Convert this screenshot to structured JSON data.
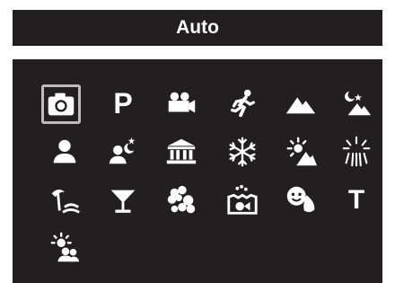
{
  "title": "Auto",
  "selected_mode": "auto-camera",
  "modes": [
    {
      "icon": "camera-icon",
      "label": ""
    },
    {
      "icon": "program-icon",
      "label": "P"
    },
    {
      "icon": "movie-camera-icon",
      "label": ""
    },
    {
      "icon": "sports-runner-icon",
      "label": ""
    },
    {
      "icon": "landscape-icon",
      "label": ""
    },
    {
      "icon": "night-landscape-icon",
      "label": ""
    },
    {
      "icon": "portrait-icon",
      "label": ""
    },
    {
      "icon": "night-portrait-icon",
      "label": ""
    },
    {
      "icon": "museum-icon",
      "label": ""
    },
    {
      "icon": "snow-icon",
      "label": ""
    },
    {
      "icon": "backlight-icon",
      "label": ""
    },
    {
      "icon": "fireworks-icon",
      "label": ""
    },
    {
      "icon": "beach-icon",
      "label": ""
    },
    {
      "icon": "party-icon",
      "label": ""
    },
    {
      "icon": "flower-icon",
      "label": ""
    },
    {
      "icon": "underwater-icon",
      "label": ""
    },
    {
      "icon": "kids-pets-icon",
      "label": ""
    },
    {
      "icon": "text-icon",
      "label": "T"
    },
    {
      "icon": "sunset-icon",
      "label": ""
    }
  ],
  "colors": {
    "panel": "#231f20",
    "icon": "#ffffff",
    "selection_border": "#bdbdbd"
  }
}
